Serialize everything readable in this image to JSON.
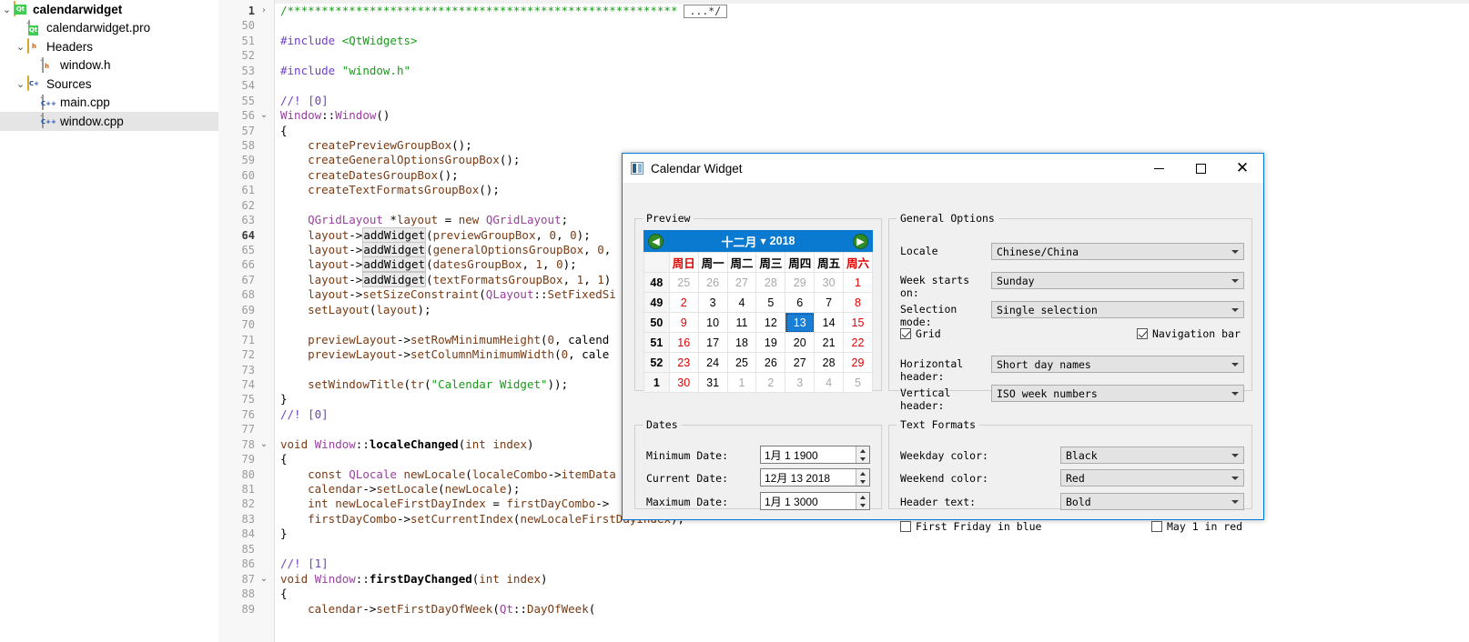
{
  "project_tree": [
    {
      "label": "calendarwidget",
      "icon": "qt-project-icon",
      "depth": 0,
      "chevron": "v",
      "bold": true,
      "selected": false,
      "kind": "folder-qt"
    },
    {
      "label": "calendarwidget.pro",
      "icon": "qt-pro-file-icon",
      "depth": 1,
      "chevron": "",
      "bold": false,
      "selected": false,
      "kind": "file-qt"
    },
    {
      "label": "Headers",
      "icon": "headers-folder-icon",
      "depth": 1,
      "chevron": "v",
      "bold": false,
      "selected": false,
      "kind": "folder-h"
    },
    {
      "label": "window.h",
      "icon": "header-file-icon",
      "depth": 2,
      "chevron": "",
      "bold": false,
      "selected": false,
      "kind": "file-h"
    },
    {
      "label": "Sources",
      "icon": "sources-folder-icon",
      "depth": 1,
      "chevron": "v",
      "bold": false,
      "selected": false,
      "kind": "folder-cpp"
    },
    {
      "label": "main.cpp",
      "icon": "cpp-file-icon",
      "depth": 2,
      "chevron": "",
      "bold": false,
      "selected": false,
      "kind": "file-cpp"
    },
    {
      "label": "window.cpp",
      "icon": "cpp-file-icon",
      "depth": 2,
      "chevron": "",
      "bold": false,
      "selected": true,
      "kind": "file-cpp"
    }
  ],
  "editor": {
    "fold_badge": "...*/",
    "lines": [
      {
        "n": "1",
        "fold": ">",
        "current": true,
        "text": "/*********************************************************"
      },
      {
        "n": "50",
        "fold": "",
        "text": ""
      },
      {
        "n": "51",
        "fold": "",
        "text": "#include <QtWidgets>"
      },
      {
        "n": "52",
        "fold": "",
        "text": ""
      },
      {
        "n": "53",
        "fold": "",
        "text": "#include \"window.h\""
      },
      {
        "n": "54",
        "fold": "",
        "text": ""
      },
      {
        "n": "55",
        "fold": "",
        "text": "//! [0]"
      },
      {
        "n": "56",
        "fold": "v",
        "text": "Window::Window()"
      },
      {
        "n": "57",
        "fold": "",
        "text": "{"
      },
      {
        "n": "58",
        "fold": "",
        "text": "    createPreviewGroupBox();"
      },
      {
        "n": "59",
        "fold": "",
        "text": "    createGeneralOptionsGroupBox();"
      },
      {
        "n": "60",
        "fold": "",
        "text": "    createDatesGroupBox();"
      },
      {
        "n": "61",
        "fold": "",
        "text": "    createTextFormatsGroupBox();"
      },
      {
        "n": "62",
        "fold": "",
        "text": ""
      },
      {
        "n": "63",
        "fold": "",
        "text": "    QGridLayout *layout = new QGridLayout;"
      },
      {
        "n": "64",
        "fold": "",
        "current": true,
        "text": "    layout->addWidget(previewGroupBox, 0, 0);"
      },
      {
        "n": "65",
        "fold": "",
        "text": "    layout->addWidget(generalOptionsGroupBox, 0,"
      },
      {
        "n": "66",
        "fold": "",
        "text": "    layout->addWidget(datesGroupBox, 1, 0);"
      },
      {
        "n": "67",
        "fold": "",
        "text": "    layout->addWidget(textFormatsGroupBox, 1, 1)"
      },
      {
        "n": "68",
        "fold": "",
        "text": "    layout->setSizeConstraint(QLayout::SetFixedSi"
      },
      {
        "n": "69",
        "fold": "",
        "text": "    setLayout(layout);"
      },
      {
        "n": "70",
        "fold": "",
        "text": ""
      },
      {
        "n": "71",
        "fold": "",
        "text": "    previewLayout->setRowMinimumHeight(0, calend"
      },
      {
        "n": "72",
        "fold": "",
        "text": "    previewLayout->setColumnMinimumWidth(0, cale"
      },
      {
        "n": "73",
        "fold": "",
        "text": ""
      },
      {
        "n": "74",
        "fold": "",
        "text": "    setWindowTitle(tr(\"Calendar Widget\"));"
      },
      {
        "n": "75",
        "fold": "",
        "text": "}"
      },
      {
        "n": "76",
        "fold": "",
        "text": "//! [0]"
      },
      {
        "n": "77",
        "fold": "",
        "text": ""
      },
      {
        "n": "78",
        "fold": "v",
        "text": "void Window::localeChanged(int index)"
      },
      {
        "n": "79",
        "fold": "",
        "text": "{"
      },
      {
        "n": "80",
        "fold": "",
        "text": "    const QLocale newLocale(localeCombo->itemData"
      },
      {
        "n": "81",
        "fold": "",
        "text": "    calendar->setLocale(newLocale);"
      },
      {
        "n": "82",
        "fold": "",
        "text": "    int newLocaleFirstDayIndex = firstDayCombo->"
      },
      {
        "n": "83",
        "fold": "",
        "text": "    firstDayCombo->setCurrentIndex(newLocaleFirstDayIndex);"
      },
      {
        "n": "84",
        "fold": "",
        "text": "}"
      },
      {
        "n": "85",
        "fold": "",
        "text": ""
      },
      {
        "n": "86",
        "fold": "",
        "text": "//! [1]"
      },
      {
        "n": "87",
        "fold": "v",
        "text": "void Window::firstDayChanged(int index)"
      },
      {
        "n": "88",
        "fold": "",
        "text": "{"
      },
      {
        "n": "89",
        "fold": "",
        "text": "    calendar->setFirstDayOfWeek(Qt::DayOfWeek("
      }
    ]
  },
  "dialog": {
    "title": "Calendar Widget",
    "buttons": {
      "minimize": "—",
      "maximize": "□",
      "close": "✕"
    },
    "preview": {
      "group_title": "Preview",
      "nav": {
        "prev": "◀",
        "next": "▶",
        "month": "十二月",
        "caret": "▼",
        "year": "2018"
      },
      "day_headers": [
        "周日",
        "周一",
        "周二",
        "周三",
        "周四",
        "周五",
        "周六"
      ],
      "weeks": [
        {
          "wk": "48",
          "days": [
            {
              "d": "25",
              "s": "dim"
            },
            {
              "d": "26",
              "s": "dim"
            },
            {
              "d": "27",
              "s": "dim"
            },
            {
              "d": "28",
              "s": "dim"
            },
            {
              "d": "29",
              "s": "dim"
            },
            {
              "d": "30",
              "s": "dim"
            },
            {
              "d": "1",
              "s": "red"
            }
          ]
        },
        {
          "wk": "49",
          "days": [
            {
              "d": "2",
              "s": "red"
            },
            {
              "d": "3",
              "s": ""
            },
            {
              "d": "4",
              "s": ""
            },
            {
              "d": "5",
              "s": ""
            },
            {
              "d": "6",
              "s": ""
            },
            {
              "d": "7",
              "s": ""
            },
            {
              "d": "8",
              "s": "red"
            }
          ]
        },
        {
          "wk": "50",
          "days": [
            {
              "d": "9",
              "s": "red"
            },
            {
              "d": "10",
              "s": ""
            },
            {
              "d": "11",
              "s": ""
            },
            {
              "d": "12",
              "s": ""
            },
            {
              "d": "13",
              "s": "sel"
            },
            {
              "d": "14",
              "s": ""
            },
            {
              "d": "15",
              "s": "red"
            }
          ]
        },
        {
          "wk": "51",
          "days": [
            {
              "d": "16",
              "s": "red"
            },
            {
              "d": "17",
              "s": ""
            },
            {
              "d": "18",
              "s": ""
            },
            {
              "d": "19",
              "s": ""
            },
            {
              "d": "20",
              "s": ""
            },
            {
              "d": "21",
              "s": ""
            },
            {
              "d": "22",
              "s": "red"
            }
          ]
        },
        {
          "wk": "52",
          "days": [
            {
              "d": "23",
              "s": "red"
            },
            {
              "d": "24",
              "s": ""
            },
            {
              "d": "25",
              "s": ""
            },
            {
              "d": "26",
              "s": ""
            },
            {
              "d": "27",
              "s": ""
            },
            {
              "d": "28",
              "s": ""
            },
            {
              "d": "29",
              "s": "red"
            }
          ]
        },
        {
          "wk": "1",
          "days": [
            {
              "d": "30",
              "s": "red"
            },
            {
              "d": "31",
              "s": ""
            },
            {
              "d": "1",
              "s": "dim"
            },
            {
              "d": "2",
              "s": "dim"
            },
            {
              "d": "3",
              "s": "dim"
            },
            {
              "d": "4",
              "s": "dim"
            },
            {
              "d": "5",
              "s": "dim"
            }
          ]
        }
      ]
    },
    "general_options": {
      "group_title": "General Options",
      "locale_label": "Locale",
      "locale_value": "Chinese/China",
      "week_starts_label": "Week starts on:",
      "week_starts_value": "Sunday",
      "selection_mode_label": "Selection mode:",
      "selection_mode_value": "Single selection",
      "grid_label": "Grid",
      "grid_checked": true,
      "navbar_label": "Navigation bar",
      "navbar_checked": true,
      "horizontal_header_label": "Horizontal header:",
      "horizontal_header_value": "Short day names",
      "vertical_header_label": "Vertical header:",
      "vertical_header_value": "ISO week numbers"
    },
    "dates": {
      "group_title": "Dates",
      "minimum_label": "Minimum Date:",
      "minimum_value": "1月 1 1900",
      "current_label": "Current Date:",
      "current_value": "12月 13 2018",
      "maximum_label": "Maximum Date:",
      "maximum_value": "1月 1 3000"
    },
    "text_formats": {
      "group_title": "Text Formats",
      "weekday_label": "Weekday color:",
      "weekday_value": "Black",
      "weekend_label": "Weekend color:",
      "weekend_value": "Red",
      "header_text_label": "Header text:",
      "header_text_value": "Bold",
      "first_friday_label": "First Friday in blue",
      "first_friday_checked": false,
      "may_one_label": "May 1 in red",
      "may_one_checked": false
    }
  },
  "colors": {
    "accent": "#0a7ad1",
    "title_border": "#0078d7",
    "weekend": "#e00000",
    "selection": "#1a7fd4",
    "nav_green": "#2e8b28"
  }
}
